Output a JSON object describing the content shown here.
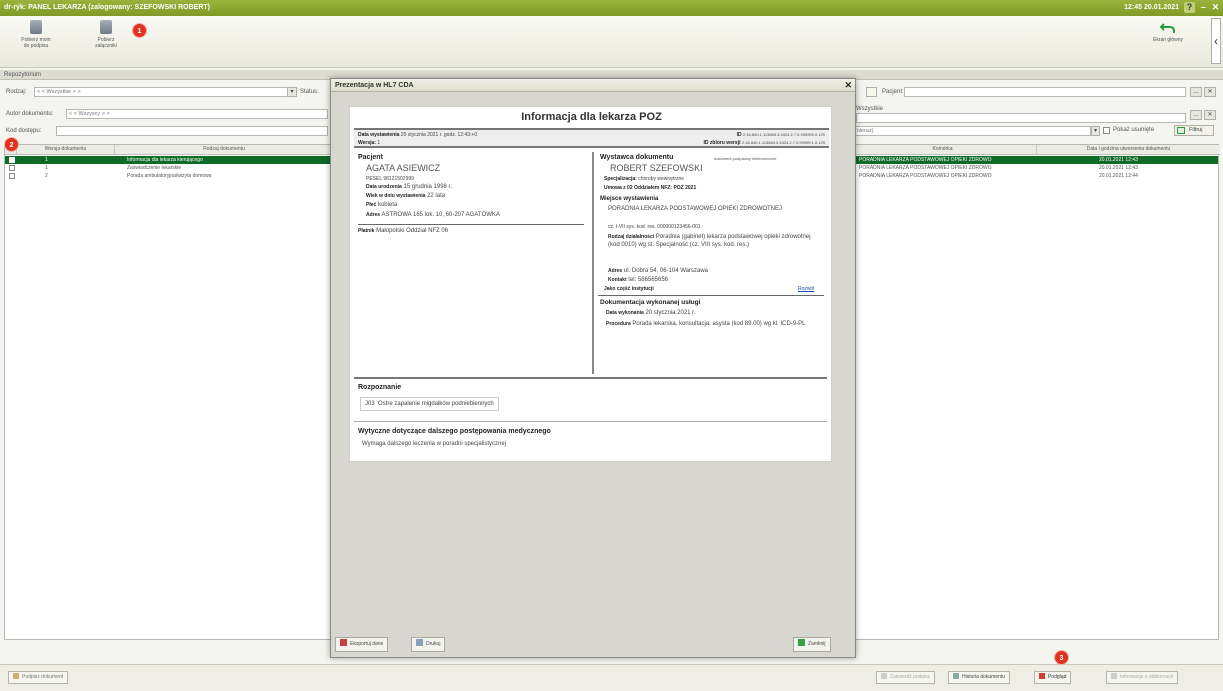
{
  "titlebar": {
    "title": "dr-rýk: PANEL LEKARZA (zalogowany: SZEFOWSKI ROBERT)",
    "clock": "12:45 20.01.2021",
    "help": "?",
    "minimize": "–",
    "close": "✕"
  },
  "toolbar": {
    "left_buttons": [
      {
        "label": "Pobierz mom do podpisu"
      },
      {
        "label": "Pobierz załączniki"
      }
    ],
    "badge_1": "1",
    "exit_label": "Ekran główny",
    "collapse": "‹"
  },
  "section_header": "Repozytorium",
  "filters": {
    "rodzaj_label": "Rodzaj:",
    "rodzaj_value": "< < Wszystkie > >",
    "status_label": "Status:",
    "autor_label": "Autor dokumentu:",
    "autor_value": "< < Wszyscy > >",
    "kod_label": "Kod dostępu:",
    "kod_value": "",
    "pacjent_label": "Pacjent:",
    "pacjent_value": "",
    "wszystkie_label": "Wszystkie",
    "wszystkie_value": "",
    "okres_value": "ala (nieraz)",
    "pokaz_usuniete": "Pokaż usunięte",
    "filtruj": "Filtruj",
    "more": "…",
    "clear": "✕"
  },
  "left_grid": {
    "badge_2": "2",
    "columns": [
      "Wersja dokumentu",
      "Rodzaj dokumentu"
    ],
    "rows": [
      {
        "version": "1",
        "type": "Informacja dla lekarza kierującego",
        "selected": true
      },
      {
        "version": "1",
        "type": "Zaświadczenie lekarskie",
        "selected": false
      },
      {
        "version": "2",
        "type": "Porada ambulatoryjna/wizyta domowa",
        "selected": false
      }
    ]
  },
  "right_grid": {
    "columns": [
      "Komórka",
      "Data i godzina utworzenia dokumentu"
    ],
    "rows": [
      {
        "unit": "PORADNIA LEKARZA PODSTAWOWEJ OPIEKI ZDROWO",
        "date": "20.01.2021 12:43",
        "selected": true
      },
      {
        "unit": "PORADNIA LEKARZA PODSTAWOWEJ OPIEKI ZDROWO",
        "date": "20.01.2021 12:43",
        "selected": false
      },
      {
        "unit": "PORADNIA LEKARZA PODSTAWOWEJ OPIEKI ZDROWO",
        "date": "20.01.2021 12:44",
        "selected": false
      }
    ]
  },
  "modal": {
    "title": "Prezentacja w HL7 CDA",
    "close": "✕",
    "doc_title": "Informacja dla lekarza POZ",
    "data_wystawienia_label": "Data wystawienia",
    "data_wystawienia": "20 stycznia 2021 r. godz. 12:43:+0",
    "wersja_label": "Wersja:",
    "wersja": "1",
    "id_label": "ID",
    "id_value": "2.16.840.1.113883.3.4424.2.7.0.999999.0.129",
    "id_zbioru_label": "ID zbioru wersji",
    "id_zbioru_value": "2.16.840.1.113883.3.4424.2.7.0.99999.1.0.129",
    "pacjent_header": "Pacjent",
    "pacjent_name": "AGATA ASIEWICZ",
    "pesel": "PESEL 98121502999",
    "urodzenie_label": "Data urodzenia",
    "urodzenie": "15 grudnia 1998 r.",
    "wiek_label": "Wiek w dniu wystawienia",
    "wiek": "22 lata",
    "plec_label": "Płeć",
    "plec": "kobieta",
    "adres_p_label": "Adres",
    "adres_p": "ASTROWA 165 lok. 10, 60-207 AGATÓWKA",
    "platnik_label": "Płatnik",
    "platnik": "Małopolski Oddział NFZ 06",
    "wystawca_header": "Wystawca dokumentu",
    "wystawca_note": "dokument podpisany elektronicznie",
    "wystawca_name": "ROBERT SZEFOWSKI",
    "specjalizacja_label": "Specjalizacja:",
    "specjalizacja": "choroby wewnętrzne",
    "umowa": "Umowa z 02 Oddziałem NFZ: POZ 2021",
    "miejsce_header": "Miejsce wystawienia",
    "miejsce_name": "PORADNIA LEKARZA PODSTAWOWEJ OPIEKI ZDROWOTNEJ",
    "miejsce_code": "cz. I-VII sys. kod. res. 000000123456-001",
    "rodzaj_label": "Rodzaj działalności",
    "rodzaj": "Poradnia (gabinet) lekarza podstawowej opieki zdrowotnej (kod 0010) wg st. Specjalność (cz. VIII sys. kod. res.)",
    "adres_w_label": "Adres",
    "adres_w": "ul. Dobra 54, 06-104 Warszawa",
    "kontakt_label": "Kontakt",
    "kontakt": "tel: 586565656",
    "instytucja_label": "Jako część instytucji",
    "instytucja_link": "Rozwiń",
    "dok_header": "Dokumentacja wykonanej usługi",
    "data_wyk_label": "Data wykonania",
    "data_wyk": "20 stycznia 2021 r.",
    "procedura_label": "Procedura",
    "procedura": "Porada lekarska, konsultacja, asysta (kod 89.00) wg kl. ICD-9-PL",
    "rozpoznanie_header": "Rozpoznanie",
    "rozpoznanie_code": "J03",
    "rozpoznanie_text": "Ostre zapalenie migdałków podniebiennych",
    "wytyczne_header": "Wytyczne dotyczące dalszego postępowania medycznego",
    "wytyczne_text": "Wymaga dalszego leczenia w poradni specjalistycznej",
    "btn_export": "Eksportuj dane",
    "btn_print": "Drukuj",
    "btn_close": "Zamknij"
  },
  "bottom": {
    "left_button": "Podpisz dokument",
    "buttons": [
      "Zatwierdź podpisz",
      "Historia dokumentu",
      "Podgląd",
      "Informacja o odbiorcach"
    ],
    "badge_3": "3"
  },
  "colors": {
    "titlebar": "#8ba831",
    "selected_row": "#0d6b26",
    "badge": "#e03222",
    "link": "#1a4fb0"
  }
}
